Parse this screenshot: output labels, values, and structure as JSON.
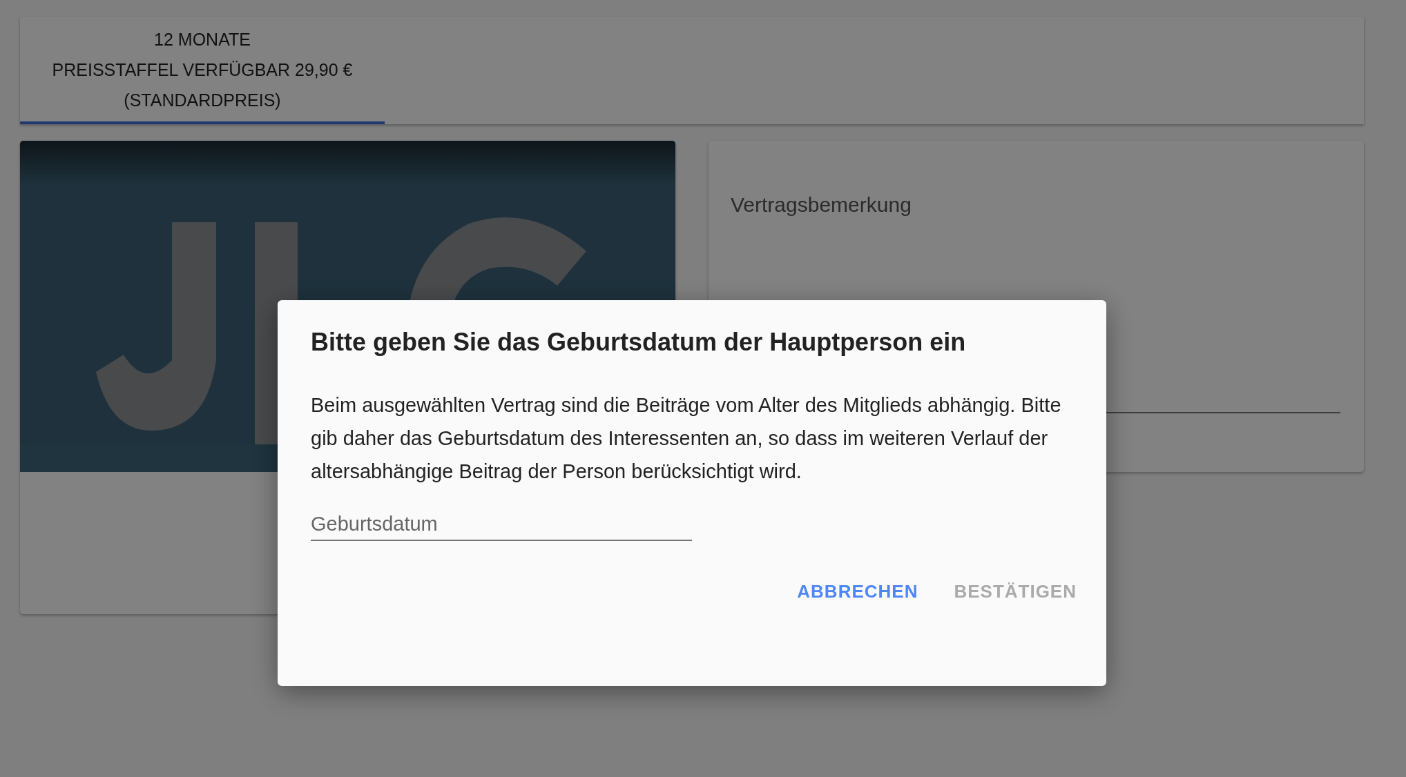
{
  "tabs": [
    {
      "label_lines": [
        "12 MONATE",
        "PREISSTAFFEL VERFÜGBAR 29,90 €",
        "(STANDARDPREIS)"
      ],
      "selected": true
    }
  ],
  "right_card": {
    "field": {
      "placeholder": "Vertragsbemerkung"
    }
  },
  "dialog": {
    "title": "Bitte geben Sie das Geburtsdatum der Hauptperson ein",
    "body": "Beim ausgewählten Vertrag sind die Beiträge vom Alter des Mitglieds abhängig. Bitte gib daher das Geburtsdatum des Interessenten an, so dass im weiteren Verlauf der altersabhängige Beitrag der Person berücksichtigt wird.",
    "field": {
      "placeholder": "Geburtsdatum"
    },
    "buttons": [
      {
        "label": "ABBRECHEN",
        "disabled": false
      },
      {
        "label": "BESTÄTIGEN",
        "disabled": true
      }
    ]
  }
}
